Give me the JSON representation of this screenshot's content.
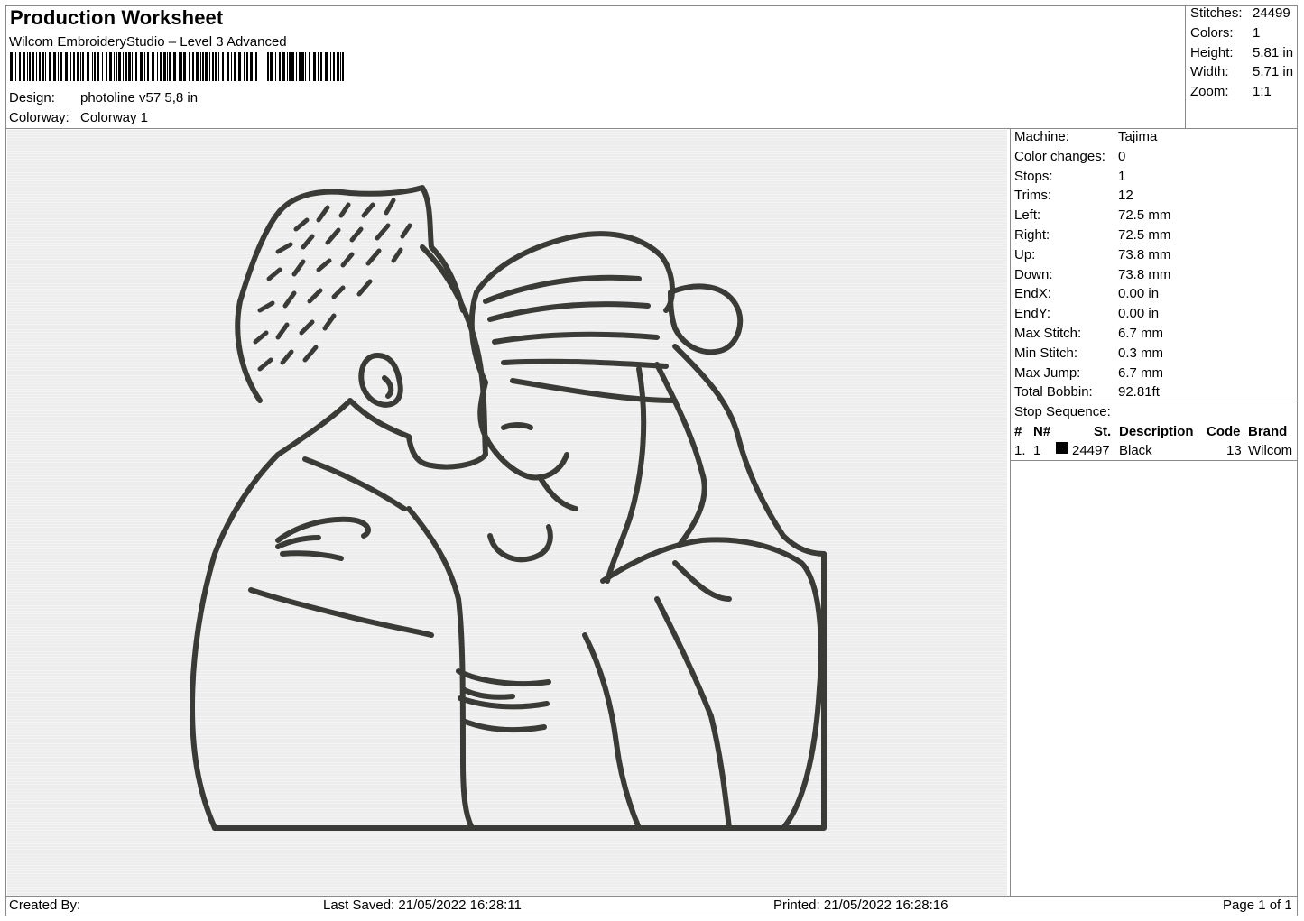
{
  "header": {
    "title": "Production Worksheet",
    "subtitle": "Wilcom EmbroideryStudio – Level 3 Advanced",
    "design_label": "Design:",
    "design_value": "photoline v57 5,8 in",
    "colorway_label": "Colorway:",
    "colorway_value": "Colorway 1"
  },
  "stats": [
    {
      "label": "Stitches:",
      "value": "24499"
    },
    {
      "label": "Colors:",
      "value": "1"
    },
    {
      "label": "Height:",
      "value": "5.81 in"
    },
    {
      "label": "Width:",
      "value": "5.71 in"
    },
    {
      "label": "Zoom:",
      "value": "1:1"
    }
  ],
  "machine_info": [
    {
      "label": "Machine:",
      "value": "Tajima"
    },
    {
      "label": "Color changes:",
      "value": "0"
    },
    {
      "label": "Stops:",
      "value": "1"
    },
    {
      "label": "Trims:",
      "value": "12"
    },
    {
      "label": "Left:",
      "value": "72.5 mm"
    },
    {
      "label": "Right:",
      "value": "72.5 mm"
    },
    {
      "label": "Up:",
      "value": "73.8 mm"
    },
    {
      "label": "Down:",
      "value": "73.8 mm"
    },
    {
      "label": "EndX:",
      "value": "0.00 in"
    },
    {
      "label": "EndY:",
      "value": "0.00 in"
    },
    {
      "label": "Max Stitch:",
      "value": "6.7 mm"
    },
    {
      "label": "Min Stitch:",
      "value": "0.3 mm"
    },
    {
      "label": "Max Jump:",
      "value": "6.7 mm"
    },
    {
      "label": "Total Bobbin:",
      "value": "92.81ft"
    }
  ],
  "stop_sequence": {
    "title": "Stop Sequence:",
    "headers": {
      "num": "#",
      "n": "N#",
      "st": "St.",
      "description": "Description",
      "code": "Code",
      "brand": "Brand"
    },
    "rows": [
      {
        "num": "1.",
        "n": "1",
        "st": "24497",
        "description": "Black",
        "code": "13",
        "brand": "Wilcom",
        "color": "#000000"
      }
    ]
  },
  "design_preview": {
    "thread_color": "#3a3a36",
    "background_color": "#ededed"
  },
  "footer": {
    "created_by": "Created By:",
    "last_saved": "Last Saved: 21/05/2022 16:28:11",
    "printed": "Printed: 21/05/2022 16:28:16",
    "page": "Page 1 of 1"
  }
}
